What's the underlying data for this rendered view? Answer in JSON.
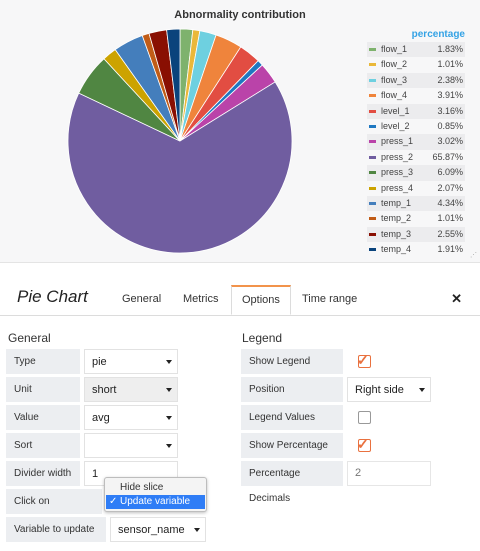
{
  "chart": {
    "title": "Abnormality contribution",
    "legend_header": "percentage"
  },
  "chart_data": {
    "type": "pie",
    "title": "Abnormality contribution",
    "legend_placement": "right",
    "slices": [
      {
        "name": "flow_1",
        "value": 1.83,
        "label": "1.83%",
        "color": "#7eb26d"
      },
      {
        "name": "flow_2",
        "value": 1.01,
        "label": "1.01%",
        "color": "#eab839"
      },
      {
        "name": "flow_3",
        "value": 2.38,
        "label": "2.38%",
        "color": "#6ed0e0"
      },
      {
        "name": "flow_4",
        "value": 3.91,
        "label": "3.91%",
        "color": "#ef843c"
      },
      {
        "name": "level_1",
        "value": 3.16,
        "label": "3.16%",
        "color": "#e24d42"
      },
      {
        "name": "level_2",
        "value": 0.85,
        "label": "0.85%",
        "color": "#1f78c1"
      },
      {
        "name": "press_1",
        "value": 3.02,
        "label": "3.02%",
        "color": "#ba43a9"
      },
      {
        "name": "press_2",
        "value": 65.87,
        "label": "65.87%",
        "color": "#705da0"
      },
      {
        "name": "press_3",
        "value": 6.09,
        "label": "6.09%",
        "color": "#508642"
      },
      {
        "name": "press_4",
        "value": 2.07,
        "label": "2.07%",
        "color": "#cca300"
      },
      {
        "name": "temp_1",
        "value": 4.34,
        "label": "4.34%",
        "color": "#447ebc"
      },
      {
        "name": "temp_2",
        "value": 1.01,
        "label": "1.01%",
        "color": "#c15c17"
      },
      {
        "name": "temp_3",
        "value": 2.55,
        "label": "2.55%",
        "color": "#890f02"
      },
      {
        "name": "temp_4",
        "value": 1.91,
        "label": "1.91%",
        "color": "#0a437c"
      }
    ]
  },
  "editor": {
    "title": "Pie Chart",
    "tabs": [
      "General",
      "Metrics",
      "Options",
      "Time range"
    ],
    "active_tab": "Options",
    "close_icon": "close-icon",
    "general": {
      "heading": "General",
      "type_label": "Type",
      "type_value": "pie",
      "unit_label": "Unit",
      "unit_value": "short",
      "value_label": "Value",
      "value_value": "avg",
      "sort_label": "Sort",
      "sort_value": "",
      "divider_label": "Divider width",
      "divider_value": "1",
      "click_label": "Click on pies/entries",
      "variable_label": "Variable to update",
      "variable_value": "sensor_name"
    },
    "legend": {
      "heading": "Legend",
      "show_legend_label": "Show Legend",
      "show_legend": true,
      "position_label": "Position",
      "position_value": "Right side",
      "values_label": "Legend Values",
      "values": false,
      "show_percentage_label": "Show Percentage",
      "show_percentage": true,
      "decimals_label": "Percentage Decimals",
      "decimals_placeholder": "2"
    },
    "popup": {
      "options": [
        "Hide slice",
        "Update variable"
      ],
      "selected": "Update variable",
      "check": "✓"
    }
  }
}
